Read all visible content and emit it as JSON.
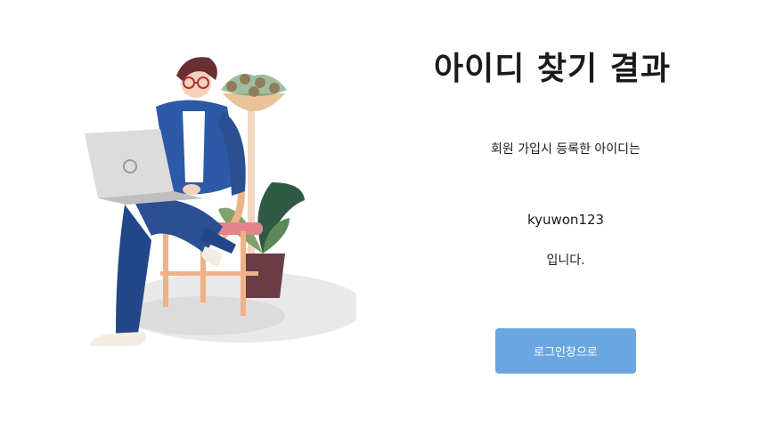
{
  "result": {
    "title": "아이디 찾기 결과",
    "subtitle": "회원 가입시 등록한 아이디는",
    "user_id": "kyuwon123",
    "suffix": "입니다."
  },
  "actions": {
    "login_button_label": "로그인창으로"
  },
  "colors": {
    "button_bg": "#6aa7e0",
    "button_text": "#ffffff"
  }
}
